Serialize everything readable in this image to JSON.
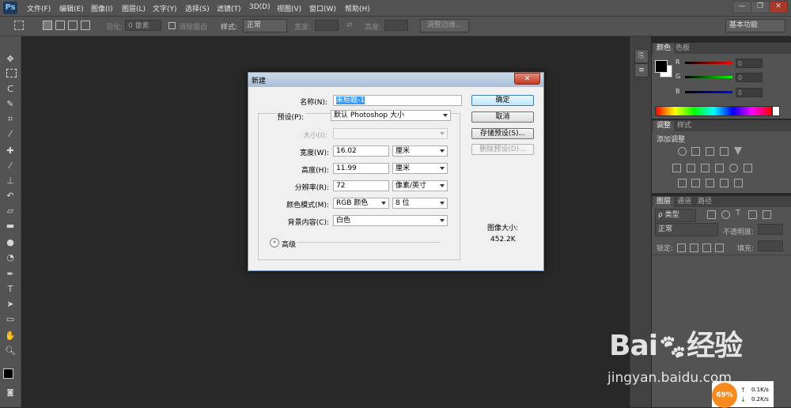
{
  "app": {
    "logo": "Ps"
  },
  "menus": [
    "文件(F)",
    "编辑(E)",
    "图像(I)",
    "图层(L)",
    "文字(Y)",
    "选择(S)",
    "滤镜(T)",
    "3D(D)",
    "视图(V)",
    "窗口(W)",
    "帮助(H)"
  ],
  "window_controls": {
    "minimize": "—",
    "restore": "❐",
    "close": "✕"
  },
  "options": {
    "feather_label": "羽化:",
    "feather_value": "0 像素",
    "antialias_label": "消除锯齿",
    "style_label": "样式:",
    "style_value": "正常",
    "width_label": "宽度:",
    "height_label": "高度:",
    "refine_edge": "调整边缘...",
    "workspace": "基本功能"
  },
  "color_panel": {
    "tabs": [
      "颜色",
      "色板"
    ],
    "channels": [
      {
        "label": "R",
        "value": "0"
      },
      {
        "label": "G",
        "value": "0"
      },
      {
        "label": "B",
        "value": "0"
      }
    ]
  },
  "adjust_panel": {
    "tabs": [
      "调整",
      "样式"
    ],
    "title": "添加调整"
  },
  "layers_panel": {
    "tabs": [
      "图层",
      "通道",
      "路径"
    ],
    "filter_label": "ρ 类型",
    "blend_mode": "正常",
    "opacity_label": "不透明度:",
    "lock_label": "锁定:",
    "fill_label": "填充:"
  },
  "dialog": {
    "title": "新建",
    "close": "✕",
    "name_label": "名称(N):",
    "name_value": "未标题-1",
    "preset_label": "预设(P):",
    "preset_value": "默认 Photoshop 大小",
    "size_label": "大小(I):",
    "width_label": "宽度(W):",
    "width_value": "16.02",
    "width_unit": "厘米",
    "height_label": "高度(H):",
    "height_value": "11.99",
    "height_unit": "厘米",
    "resolution_label": "分辨率(R):",
    "resolution_value": "72",
    "resolution_unit": "像素/英寸",
    "color_mode_label": "颜色模式(M):",
    "color_mode_value": "RGB 颜色",
    "bit_depth": "8 位",
    "background_label": "背景内容(C):",
    "background_value": "白色",
    "advanced_label": "高级",
    "ok": "确定",
    "cancel": "取消",
    "save_preset": "存储预设(S)...",
    "delete_preset": "删除预设(D)...",
    "image_size_label": "图像大小:",
    "image_size_value": "452.2K"
  },
  "watermark": {
    "brand": "Bai",
    "brand_cn": "经验",
    "url": "jingyan.baidu.com"
  },
  "net_widget": {
    "percent": "69%",
    "up": "0.1K/s",
    "down": "0.2K/s"
  }
}
